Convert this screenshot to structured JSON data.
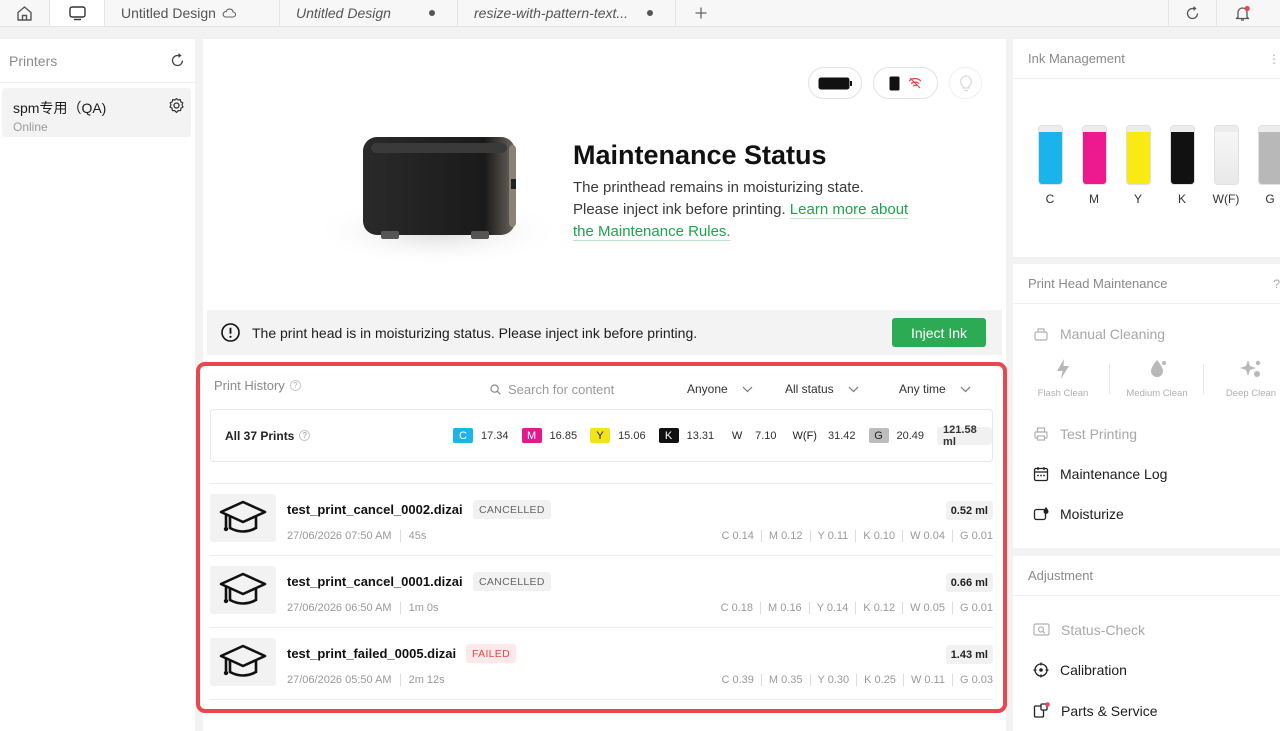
{
  "tabs": {
    "tab1": {
      "label": "Untitled Design"
    },
    "tab2": {
      "label": "Untitled Design"
    },
    "tab3": {
      "label": "resize-with-pattern-text..."
    }
  },
  "printers_panel": {
    "title": "Printers",
    "items": [
      {
        "name": "spm专用（QA)",
        "status": "Online"
      }
    ]
  },
  "maintenance": {
    "title": "Maintenance Status",
    "description": "The printhead remains in moisturizing state. Please inject ink before printing. ",
    "link_text": "Learn more about the Maintenance Rules."
  },
  "alert": {
    "text": "The print head is in moisturizing status. Please inject ink before printing.",
    "button": "Inject Ink"
  },
  "history": {
    "title": "Print History",
    "search_placeholder": "Search for content",
    "filters": {
      "user": "Anyone",
      "status": "All status",
      "time": "Any time"
    },
    "summary": {
      "label": "All 37 Prints",
      "inks": [
        {
          "tag": "C",
          "value": "17.34",
          "bg": "#1fb4e8",
          "fg": "#ffffff"
        },
        {
          "tag": "M",
          "value": "16.85",
          "bg": "#e6198c",
          "fg": "#ffffff"
        },
        {
          "tag": "Y",
          "value": "15.06",
          "bg": "#f5e31a",
          "fg": "#222222"
        },
        {
          "tag": "K",
          "value": "13.31",
          "bg": "#111111",
          "fg": "#ffffff"
        },
        {
          "tag": "W",
          "value": "7.10",
          "bg": "#ffffff",
          "fg": "#222222"
        },
        {
          "tag": "W(F)",
          "value": "31.42",
          "bg": "#ffffff",
          "fg": "#222222"
        },
        {
          "tag": "G",
          "value": "20.49",
          "bg": "#bdbdbd",
          "fg": "#222222"
        }
      ],
      "total": "121.58 ml"
    },
    "jobs": [
      {
        "name": "test_print_cancel_0002.dizai",
        "status": "CANCELLED",
        "status_kind": "cancelled",
        "date": "27/06/2026 07:50 AM",
        "duration": "45s",
        "total": "0.52 ml",
        "inks": [
          "C 0.14",
          "M 0.12",
          "Y 0.11",
          "K 0.10",
          "W 0.04",
          "G 0.01"
        ]
      },
      {
        "name": "test_print_cancel_0001.dizai",
        "status": "CANCELLED",
        "status_kind": "cancelled",
        "date": "27/06/2026 06:50 AM",
        "duration": "1m 0s",
        "total": "0.66 ml",
        "inks": [
          "C 0.18",
          "M 0.16",
          "Y 0.14",
          "K 0.12",
          "W 0.05",
          "G 0.01"
        ]
      },
      {
        "name": "test_print_failed_0005.dizai",
        "status": "FAILED",
        "status_kind": "failed",
        "date": "27/06/2026 05:50 AM",
        "duration": "2m 12s",
        "total": "1.43 ml",
        "inks": [
          "C 0.39",
          "M 0.35",
          "Y 0.30",
          "K 0.25",
          "W 0.11",
          "G 0.03"
        ]
      }
    ]
  },
  "ink_management": {
    "title": "Ink Management",
    "inks": [
      {
        "label": "C",
        "color": "#1ab4ec",
        "level": 0.9
      },
      {
        "label": "M",
        "color": "#ec1a8e",
        "level": 0.9
      },
      {
        "label": "Y",
        "color": "#f8ea12",
        "level": 0.9
      },
      {
        "label": "K",
        "color": "#111111",
        "level": 0.9
      },
      {
        "label": "W(F)",
        "color": "#f4f4f4",
        "level": 0.9
      },
      {
        "label": "G",
        "color": "#b8b8b8",
        "level": 0.9
      }
    ]
  },
  "print_head": {
    "title": "Print Head Maintenance",
    "manual_cleaning": "Manual Cleaning",
    "clean_modes": [
      "Flash Clean",
      "Medium Clean",
      "Deep Clean"
    ],
    "test_printing": "Test Printing",
    "maintenance_log": "Maintenance Log",
    "moisturize": "Moisturize"
  },
  "adjustment": {
    "title": "Adjustment",
    "status_check": "Status-Check",
    "calibration": "Calibration",
    "parts_service": "Parts & Service"
  }
}
